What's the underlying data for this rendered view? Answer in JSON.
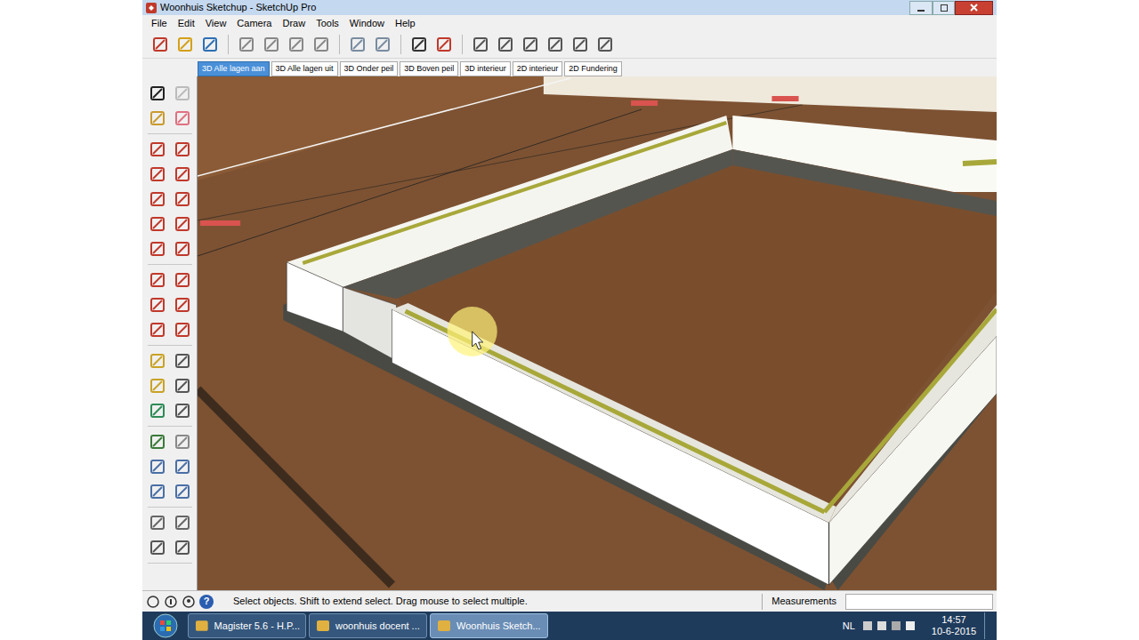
{
  "window": {
    "title": "Woonhuis Sketchup - SketchUp Pro"
  },
  "menu": [
    "File",
    "Edit",
    "View",
    "Camera",
    "Draw",
    "Tools",
    "Window",
    "Help"
  ],
  "scene_tabs": [
    {
      "label": "3D Alle lagen aan",
      "selected": true
    },
    {
      "label": "3D Alle lagen uit",
      "selected": false
    },
    {
      "label": "3D Onder peil",
      "selected": false
    },
    {
      "label": "3D Boven peil",
      "selected": false
    },
    {
      "label": "3D interieur",
      "selected": false
    },
    {
      "label": "2D interieur",
      "selected": false
    },
    {
      "label": "2D Fundering",
      "selected": false
    }
  ],
  "status_bar": {
    "help_icon": "?",
    "hint": "Select objects. Shift to extend select. Drag mouse to select multiple.",
    "measurements_label": "Measurements"
  },
  "taskbar": {
    "windows": [
      {
        "label": "Magister 5.6 - H.P...",
        "selected": false
      },
      {
        "label": "woonhuis docent ...",
        "selected": false
      },
      {
        "label": "Woonhuis Sketch...",
        "selected": true
      }
    ],
    "language": "NL",
    "time": "14:57",
    "date": "10-6-2015"
  }
}
